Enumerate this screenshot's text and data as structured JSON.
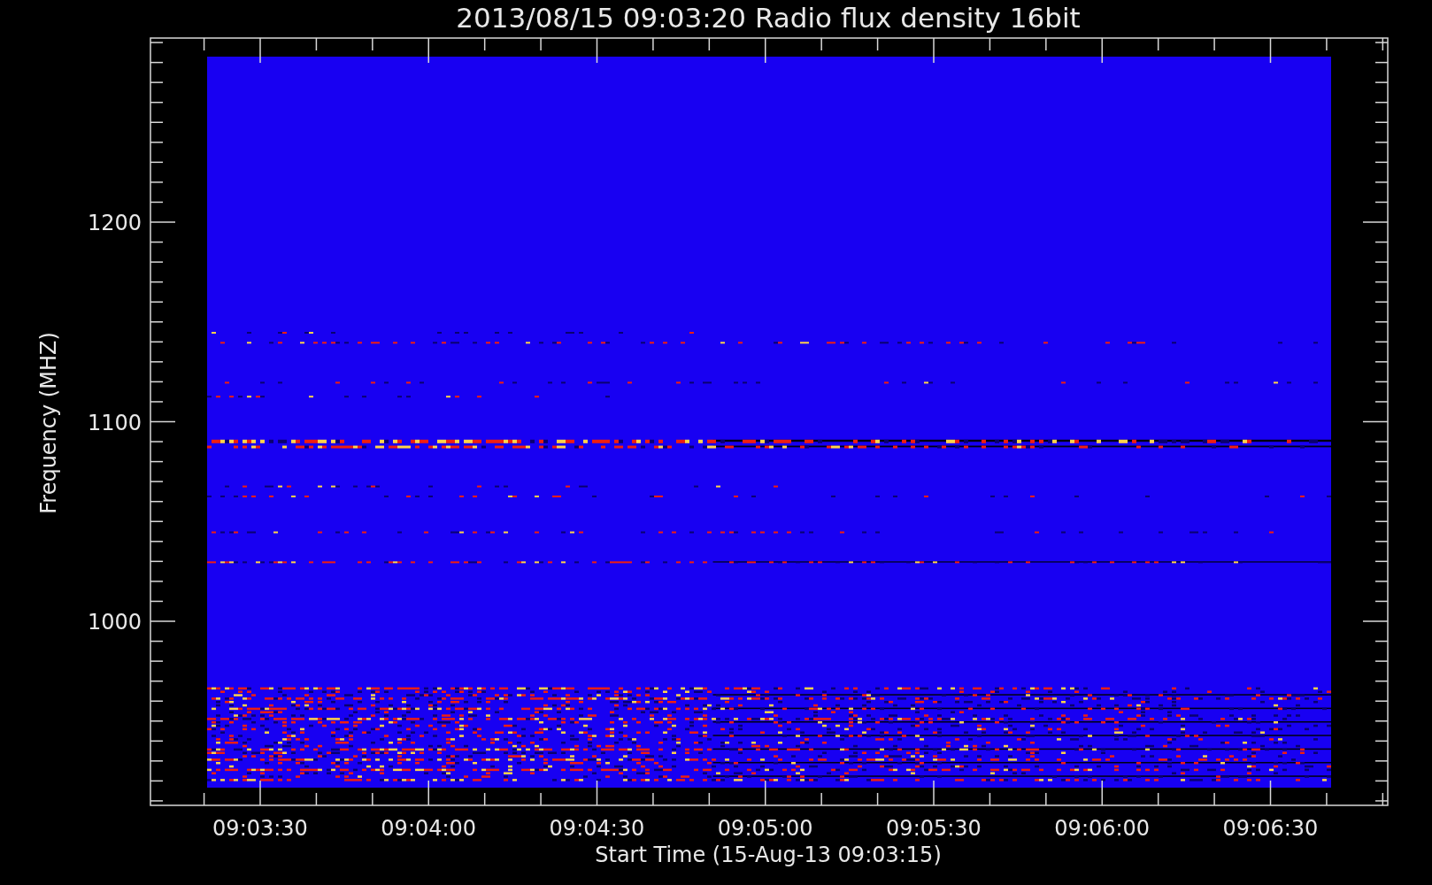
{
  "title": "2013/08/15 09:03:20 Radio flux density 16bit",
  "y_axis": {
    "label": "Frequency (MHZ)",
    "ticks": [
      "1200",
      "1100",
      "1000"
    ]
  },
  "x_axis": {
    "label": "Start Time (15-Aug-13 09:03:15)",
    "ticks": [
      "09:03:30",
      "09:04:00",
      "09:04:30",
      "09:05:00",
      "09:05:30",
      "09:06:00",
      "09:06:30"
    ]
  }
}
